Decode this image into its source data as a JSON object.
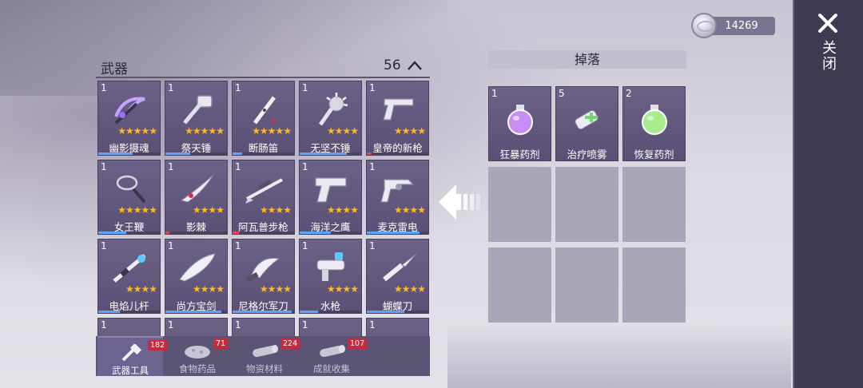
{
  "currency": {
    "amount": "14269",
    "icon": "silver-coin-icon"
  },
  "close": {
    "label": "关闭"
  },
  "weapons": {
    "title": "武器",
    "count": "56",
    "items": [
      {
        "name": "幽影摄魂",
        "count": "1",
        "stars": "★★★★★",
        "icon": "scythe-icon",
        "bar_color": "#58a6ff",
        "bar_fill": 0.55
      },
      {
        "name": "祭天锤",
        "count": "1",
        "stars": "★★★★★",
        "icon": "hammer-icon",
        "bar_color": "#58a6ff",
        "bar_fill": 0.4
      },
      {
        "name": "断肠笛",
        "count": "1",
        "stars": "★★★★★",
        "icon": "flute-icon",
        "bar_color": "#58a6ff",
        "bar_fill": 0.15
      },
      {
        "name": "无坚不锤",
        "count": "1",
        "stars": "★★★★",
        "icon": "spiked-mace-icon",
        "bar_color": "#58a6ff",
        "bar_fill": 0.75
      },
      {
        "name": "皇帝的新枪",
        "count": "1",
        "stars": "★★★★",
        "icon": "pistol-icon",
        "bar_color": "#e04455",
        "bar_fill": 0.08
      },
      {
        "name": "女王鞭",
        "count": "1",
        "stars": "★★★★★",
        "icon": "whip-icon",
        "bar_color": "#58a6ff",
        "bar_fill": 0.45
      },
      {
        "name": "影棘",
        "count": "1",
        "stars": "★★★★",
        "icon": "thorn-blade-icon",
        "bar_color": "#e04455",
        "bar_fill": 0.06
      },
      {
        "name": "阿瓦普步枪",
        "count": "1",
        "stars": "★★★★",
        "icon": "sniper-rifle-icon",
        "bar_color": "#e04455",
        "bar_fill": 0.1
      },
      {
        "name": "海洋之鹰",
        "count": "1",
        "stars": "★★★★",
        "icon": "desert-eagle-icon",
        "bar_color": "#58a6ff",
        "bar_fill": 0.5
      },
      {
        "name": "麦克雷电",
        "count": "1",
        "stars": "★★★★",
        "icon": "revolver-icon",
        "bar_color": "#58a6ff",
        "bar_fill": 0.85
      },
      {
        "name": "电焰儿杆",
        "count": "1",
        "stars": "★★★★",
        "icon": "flame-staff-icon",
        "bar_color": "#58a6ff",
        "bar_fill": 0.35
      },
      {
        "name": "尚方宝剑",
        "count": "1",
        "stars": "★★★★",
        "icon": "fish-sword-icon",
        "bar_color": "#58a6ff",
        "bar_fill": 0.9
      },
      {
        "name": "尼格尔军刀",
        "count": "1",
        "stars": "★★★★",
        "icon": "machete-icon",
        "bar_color": "#58a6ff",
        "bar_fill": 0.95
      },
      {
        "name": "水枪",
        "count": "1",
        "stars": "★★★★",
        "icon": "water-gun-icon",
        "bar_color": "#58a6ff",
        "bar_fill": 0.3
      },
      {
        "name": "蝴蝶刀",
        "count": "1",
        "stars": "★★★★",
        "icon": "butterfly-knife-icon",
        "bar_color": "#58a6ff",
        "bar_fill": 0.6
      },
      {
        "name": "",
        "count": "1",
        "stars": "",
        "icon": "",
        "bar_color": "#58a6ff",
        "bar_fill": 0
      },
      {
        "name": "",
        "count": "1",
        "stars": "",
        "icon": "",
        "bar_color": "#58a6ff",
        "bar_fill": 0
      },
      {
        "name": "",
        "count": "1",
        "stars": "",
        "icon": "",
        "bar_color": "#58a6ff",
        "bar_fill": 0
      },
      {
        "name": "",
        "count": "1",
        "stars": "",
        "icon": "",
        "bar_color": "#58a6ff",
        "bar_fill": 0
      },
      {
        "name": "",
        "count": "1",
        "stars": "",
        "icon": "",
        "bar_color": "#58a6ff",
        "bar_fill": 0
      }
    ]
  },
  "tabs": [
    {
      "label": "武器工具",
      "badge": "182",
      "active": true,
      "icon": "weapon-tool-icon"
    },
    {
      "label": "食物药品",
      "badge": "71",
      "active": false,
      "icon": "food-icon"
    },
    {
      "label": "物资材料",
      "badge": "224",
      "active": false,
      "icon": "log-icon"
    },
    {
      "label": "成就收集",
      "badge": "107",
      "active": false,
      "icon": "collection-icon"
    }
  ],
  "drops": {
    "title": "掉落",
    "items": [
      {
        "name": "狂暴药剂",
        "count": "1",
        "icon": "purple-potion-icon",
        "color": "#c98cf2"
      },
      {
        "name": "治疗喷雾",
        "count": "5",
        "icon": "healing-spray-icon",
        "color": "#6fdc6a"
      },
      {
        "name": "恢复药剂",
        "count": "2",
        "icon": "green-potion-icon",
        "color": "#a8ec8e"
      }
    ],
    "empty_slots": 6
  },
  "colors": {
    "panel": "#3f3a52",
    "card": "#6c6186",
    "star": "#ffb820",
    "badge": "#c8293d"
  }
}
